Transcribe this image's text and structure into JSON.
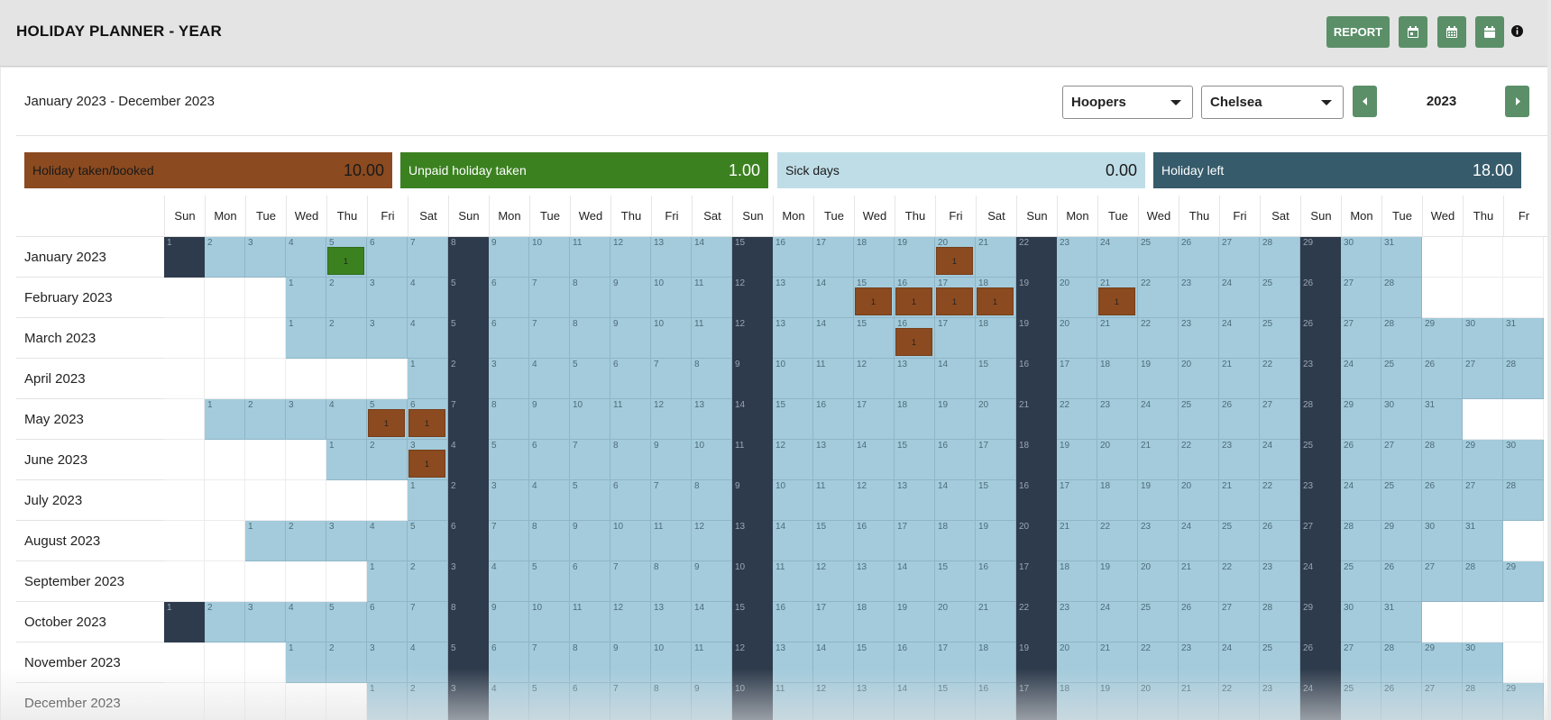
{
  "header": {
    "title": "HOLIDAY PLANNER - YEAR",
    "report_label": "REPORT",
    "icons": [
      "calendar-day-icon",
      "calendar-week-icon",
      "calendar-icon",
      "info-icon"
    ]
  },
  "toolbar": {
    "date_range": "January 2023 - December 2023",
    "company_select": "Hoopers",
    "branch_select": "Chelsea",
    "year": "2023"
  },
  "stats": [
    {
      "label": "Holiday taken/booked",
      "value": "10.00",
      "color": "#8b4a1f",
      "text_color": "#1a1a1a"
    },
    {
      "label": "Unpaid holiday taken",
      "value": "1.00",
      "color": "#3b8120",
      "text_color": "#ffffff"
    },
    {
      "label": "Sick days",
      "value": "0.00",
      "color": "#bfdde7",
      "text_color": "#1a1a1a"
    },
    {
      "label": "Holiday left",
      "value": "18.00",
      "color": "#365b6b",
      "text_color": "#ffffff"
    }
  ],
  "colors": {
    "working_day": "#a3cbdc",
    "sunday": "#2e3b4c",
    "holiday": "#8b4a1f",
    "unpaid": "#3b8120",
    "button": "#5a8f68"
  },
  "weekday_headers": [
    "Sun",
    "Mon",
    "Tue",
    "Wed",
    "Thu",
    "Fri",
    "Sat",
    "Sun",
    "Mon",
    "Tue",
    "Wed",
    "Thu",
    "Fri",
    "Sat",
    "Sun",
    "Mon",
    "Tue",
    "Wed",
    "Thu",
    "Fri",
    "Sat",
    "Sun",
    "Mon",
    "Tue",
    "Wed",
    "Thu",
    "Fri",
    "Sat",
    "Sun",
    "Mon",
    "Tue",
    "Wed",
    "Thu",
    "Fr"
  ],
  "months": [
    {
      "label": "January 2023",
      "start": 0,
      "days": 31,
      "marks": [
        {
          "day": 5,
          "type": "unpaid",
          "value": "1"
        },
        {
          "day": 20,
          "type": "holiday",
          "value": "1"
        }
      ]
    },
    {
      "label": "February 2023",
      "start": 3,
      "days": 28,
      "marks": [
        {
          "day": 15,
          "type": "holiday",
          "value": "1"
        },
        {
          "day": 16,
          "type": "holiday",
          "value": "1"
        },
        {
          "day": 17,
          "type": "holiday",
          "value": "1"
        },
        {
          "day": 18,
          "type": "holiday",
          "value": "1"
        },
        {
          "day": 21,
          "type": "holiday",
          "value": "1"
        }
      ]
    },
    {
      "label": "March 2023",
      "start": 3,
      "days": 31,
      "marks": [
        {
          "day": 16,
          "type": "holiday",
          "value": "1"
        }
      ]
    },
    {
      "label": "April 2023",
      "start": 6,
      "days": 30,
      "marks": []
    },
    {
      "label": "May 2023",
      "start": 1,
      "days": 31,
      "marks": [
        {
          "day": 5,
          "type": "holiday",
          "value": "1"
        },
        {
          "day": 6,
          "type": "holiday",
          "value": "1"
        }
      ]
    },
    {
      "label": "June 2023",
      "start": 4,
      "days": 30,
      "marks": [
        {
          "day": 3,
          "type": "holiday",
          "value": "1"
        }
      ]
    },
    {
      "label": "July 2023",
      "start": 6,
      "days": 31,
      "marks": []
    },
    {
      "label": "August 2023",
      "start": 2,
      "days": 31,
      "marks": []
    },
    {
      "label": "September 2023",
      "start": 5,
      "days": 30,
      "marks": []
    },
    {
      "label": "October 2023",
      "start": 0,
      "days": 31,
      "marks": []
    },
    {
      "label": "November 2023",
      "start": 3,
      "days": 30,
      "marks": []
    },
    {
      "label": "December 2023",
      "start": 5,
      "days": 31,
      "marks": []
    }
  ]
}
